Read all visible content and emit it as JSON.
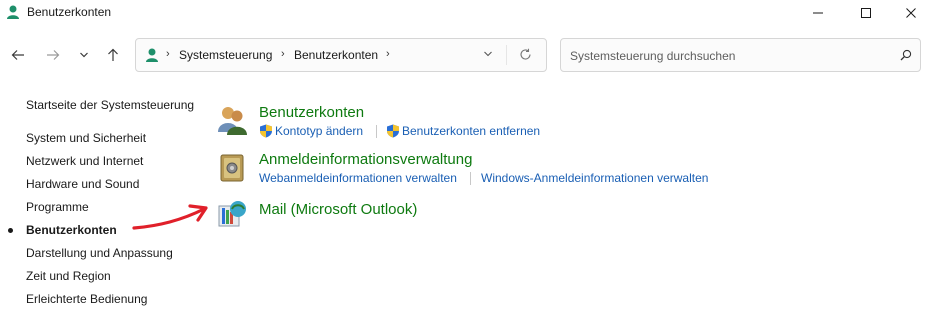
{
  "window": {
    "title": "Benutzerkonten"
  },
  "address": {
    "crumbs": [
      "Systemsteuerung",
      "Benutzerkonten"
    ]
  },
  "search": {
    "placeholder": "Systemsteuerung durchsuchen"
  },
  "sidebar": {
    "items": [
      {
        "label": "Startseite der Systemsteuerung",
        "active": false
      },
      {
        "label": "System und Sicherheit",
        "active": false
      },
      {
        "label": "Netzwerk und Internet",
        "active": false
      },
      {
        "label": "Hardware und Sound",
        "active": false
      },
      {
        "label": "Programme",
        "active": false
      },
      {
        "label": "Benutzerkonten",
        "active": true
      },
      {
        "label": "Darstellung und Anpassung",
        "active": false
      },
      {
        "label": "Zeit und Region",
        "active": false
      },
      {
        "label": "Erleichterte Bedienung",
        "active": false
      }
    ]
  },
  "main": {
    "categories": [
      {
        "title": "Benutzerkonten",
        "icon": "user-accounts-icon",
        "links": [
          "Kontotyp ändern",
          "Benutzerkonten entfernen"
        ]
      },
      {
        "title": "Anmeldeinformationsverwaltung",
        "icon": "credential-manager-icon",
        "links": [
          "Webanmeldeinformationen verwalten",
          "Windows-Anmeldeinformationen verwalten"
        ]
      },
      {
        "title": "Mail (Microsoft Outlook)",
        "icon": "mail-icon",
        "links": []
      }
    ]
  },
  "colors": {
    "category_title": "#0e7a10",
    "link": "#1a5fb4",
    "annotation_arrow": "#e0202a"
  }
}
